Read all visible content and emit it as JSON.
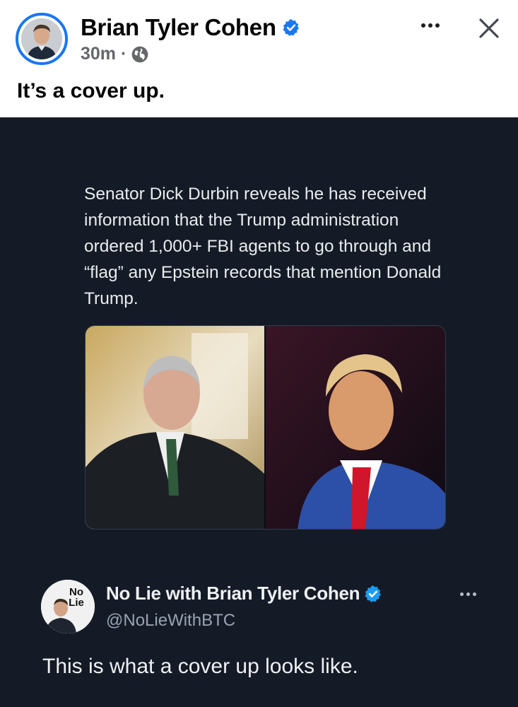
{
  "post": {
    "author_name": "Brian Tyler Cohen",
    "time": "30m ·",
    "caption": "It’s a cover up."
  },
  "icons": {
    "verified": "verified-badge-icon",
    "privacy": "globe-icon",
    "more": "more-options-icon",
    "close": "close-icon"
  },
  "card": {
    "headline": "Senator Dick Durbin reveals he has received information that the Trump administration ordered 1,000+ FBI agents to go through and “flag” any Epstein records that mention Donald Trump."
  },
  "tweet": {
    "author_name": "No Lie with Brian Tyler Cohen",
    "handle": "@NoLieWithBTC",
    "text": "This is what a cover up looks like.",
    "avatar_logo": "No Lie"
  },
  "colors": {
    "brand_blue": "#1877f2",
    "card_bg": "#151b26",
    "verified_blue": "#1d9bf0"
  }
}
